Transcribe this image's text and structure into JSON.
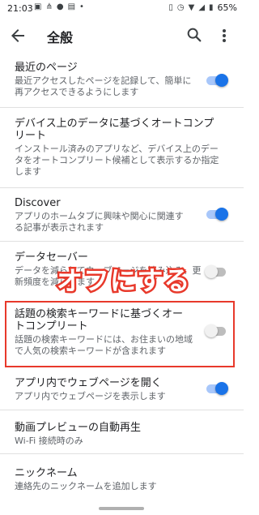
{
  "status": {
    "time": "21:03",
    "battery": "65%"
  },
  "header": {
    "title": "全般"
  },
  "settings": [
    {
      "title": "最近のページ",
      "subtitle": "最近アクセスしたページを記録して、簡単に再アクセスできるようにします",
      "toggle": "on"
    },
    {
      "title": "デバイス上のデータに基づくオートコンプリート",
      "subtitle": "インストール済みのアプリなど、デバイス上のデータをオートコンプリート候補として表示するか指定します"
    },
    {
      "title": "Discover",
      "subtitle": "アプリのホームタブに興味や関心に関連する記事が表示されます",
      "toggle": "on"
    },
    {
      "title": "データセーバー",
      "subtitle": "データを減らしてウェブページを読み込み、更新頻度を減らします",
      "toggle": "off"
    },
    {
      "title": "話題の検索キーワードに基づくオートコンプリート",
      "subtitle": "話題の検索キーワードには、お住まいの地域で人気の検索キーワードが含まれます",
      "toggle": "off"
    },
    {
      "title": "アプリ内でウェブページを開く",
      "subtitle": "アプリ内でウェブページを表示します",
      "toggle": "on"
    },
    {
      "title": "動画プレビューの自動再生",
      "subtitle": "Wi-Fi 接続時のみ"
    },
    {
      "title": "ニックネーム",
      "subtitle": "連絡先のニックネームを追加します"
    }
  ],
  "annotation": {
    "text": "オフにする"
  },
  "colors": {
    "accent": "#1a73e8",
    "highlight": "#e8392b"
  }
}
